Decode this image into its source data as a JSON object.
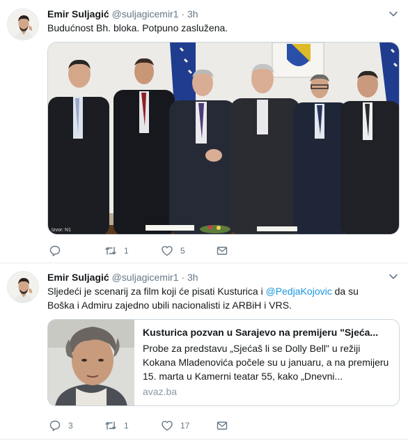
{
  "tweets": [
    {
      "author": {
        "name": "Emir Suljagić",
        "handle": "@suljagicemir1"
      },
      "dot": "·",
      "time": "3h",
      "text": "Budućnost Bh. bloka. Potpuno zaslužena.",
      "media": {
        "caption": "Izvor: N1"
      },
      "actions": {
        "replies": "",
        "retweets": "1",
        "likes": "5"
      }
    },
    {
      "author": {
        "name": "Emir Suljagić",
        "handle": "@suljagicemir1"
      },
      "dot": "·",
      "time": "3h",
      "text_before": "Sljedeći je scenarij za film koji će pisati Kusturica i ",
      "mention": "@PedjaKojovic",
      "text_after": " da su Boška i Admiru zajedno ubili nacionalisti iz ARBiH i VRS.",
      "card": {
        "title": "Kusturica pozvan u Sarajevo na premijeru \"Sjeća...",
        "description": "Probe za predstavu „Sjećaš li se Dolly Bell\" u režiji Kokana Mladenovića počele su u januaru, a na premijeru 15. marta u Kamerni teatar 55, kako „Dnevni...",
        "domain": "avaz.ba"
      },
      "actions": {
        "replies": "3",
        "retweets": "1",
        "likes": "17"
      }
    }
  ],
  "colors": {
    "accent": "#1b95e0",
    "muted": "#657786",
    "border": "#e6ecf0"
  },
  "icons": [
    "avatar",
    "chevron-down-icon",
    "reply-icon",
    "retweet-icon",
    "like-icon",
    "direct-message-icon"
  ]
}
